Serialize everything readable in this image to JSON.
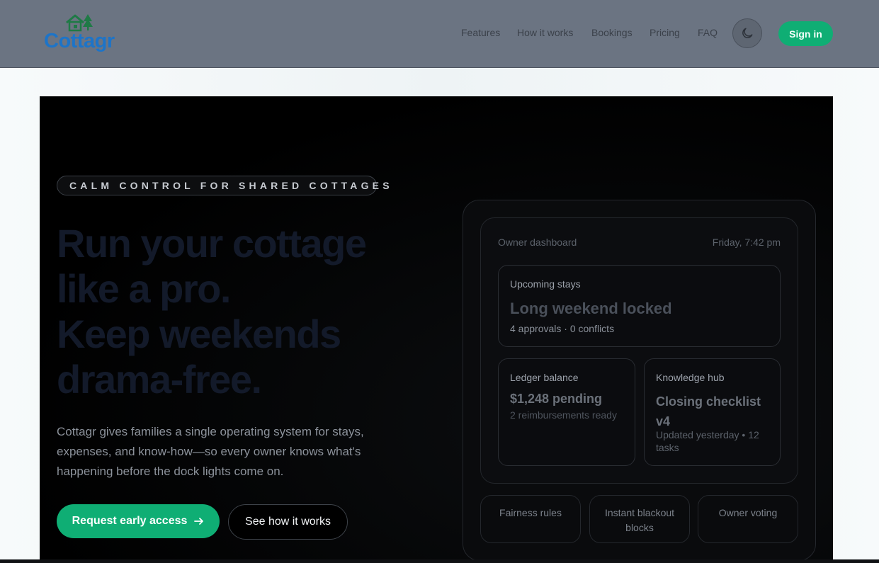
{
  "header": {
    "brand": "Cottagr",
    "nav": [
      "Features",
      "How it works",
      "Bookings",
      "Pricing",
      "FAQ"
    ],
    "theme_icon": "moon-icon",
    "signin_label": "Sign in"
  },
  "hero": {
    "eyebrow": "CALM CONTROL FOR SHARED COTTAGES",
    "headline": [
      "Run your cottage",
      "like a pro.",
      "Keep weekends",
      "drama-free."
    ],
    "lead": "Cottagr gives families a single operating system for stays, expenses, and know-how—so every owner knows what's happening before the dock lights come on.",
    "cta_primary": "Request early access",
    "cta_primary_icon": "arrow-right-icon",
    "cta_secondary": "See how it works"
  },
  "dashboard": {
    "title": "Owner dashboard",
    "time": "Friday, 7:42 pm",
    "upcoming": {
      "label": "Upcoming stays",
      "value": "Long weekend locked",
      "meta": "4 approvals · 0 conflicts"
    },
    "ledger": {
      "label": "Ledger balance",
      "value": "$1,248 pending",
      "meta": "2 reimbursements ready"
    },
    "knowledge": {
      "label": "Knowledge hub",
      "value_line1": "Closing checklist",
      "value_line2": "v4",
      "meta": "Updated yesterday • 12 tasks"
    },
    "chips": [
      "Fairness rules",
      "Instant blackout blocks",
      "Owner voting"
    ]
  },
  "colors": {
    "accent": "#0fae74",
    "brand_blue": "#1d74c8",
    "header_bg": "#6b7482",
    "hero_bg": "#000000"
  }
}
